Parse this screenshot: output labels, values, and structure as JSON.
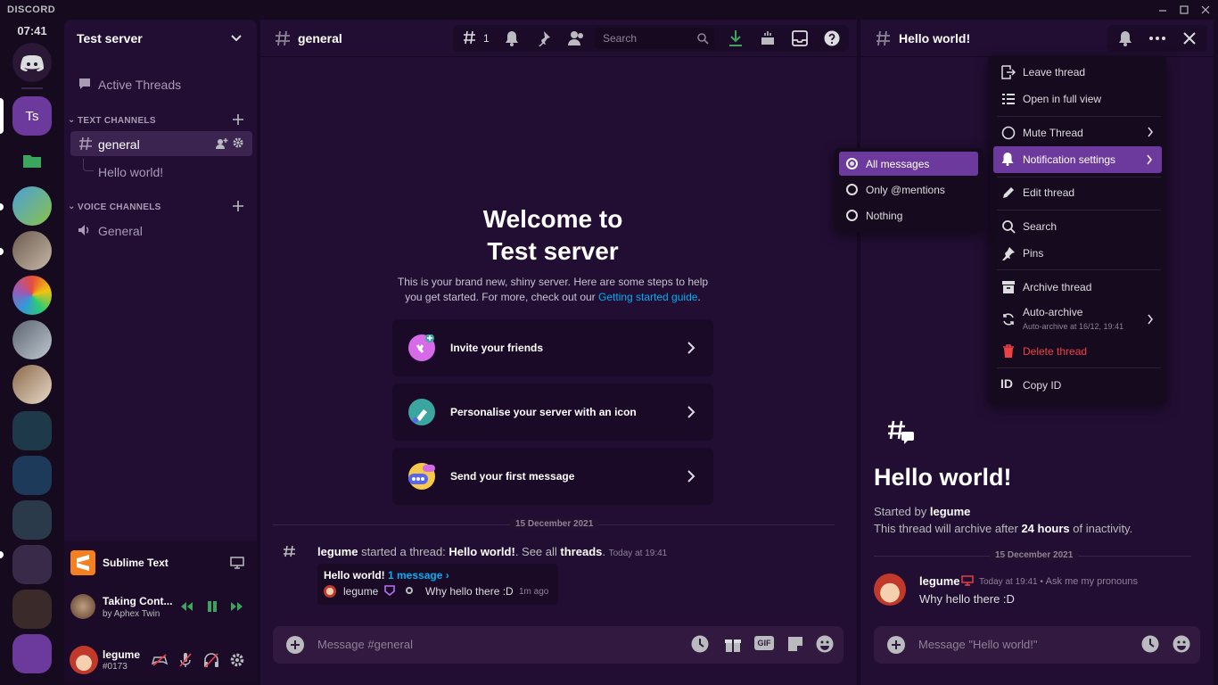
{
  "app": {
    "brand": "DISCORD",
    "time": "07:41"
  },
  "server": {
    "name": "Test server",
    "active_threads": "Active Threads",
    "text_category": "TEXT CHANNELS",
    "voice_category": "VOICE CHANNELS",
    "channels": {
      "general": "general",
      "thread": "Hello world!",
      "voice": "General"
    },
    "guild_initials": "Ts"
  },
  "activity": {
    "app_name": "Sublime Text",
    "song_title": "Taking Cont...",
    "song_artist": "by Aphex Twin"
  },
  "user": {
    "name": "legume",
    "tag": "#0173"
  },
  "main": {
    "channel": "general",
    "thread_count": "1",
    "search_placeholder": "Search",
    "welcome_line1": "Welcome to",
    "welcome_line2": "Test server",
    "welcome_sub": "This is your brand new, shiny server. Here are some steps to help you get started. For more, check out our",
    "guide_link": "Getting started guide",
    "guide_suffix": ".",
    "cards": [
      "Invite your friends",
      "Personalise your server with an icon",
      "Send your first message"
    ],
    "divider_date": "15 December 2021",
    "system_msg": {
      "user": "legume",
      "text1": " started a thread: ",
      "thread": "Hello world!",
      "text2": ". See all ",
      "threads": "threads",
      "text3": ".",
      "time": "Today at 19:41",
      "preview_title": "Hello world!",
      "preview_count": "1 message ›",
      "preview_user": "legume",
      "preview_text": "Why hello there :D",
      "preview_time": "1m ago"
    },
    "composer_placeholder": "Message #general"
  },
  "thread": {
    "title": "Hello world!",
    "big_title": "Hello world!",
    "started_by": "Started by ",
    "starter": "legume",
    "archive_pre": "This thread will archive after ",
    "archive_hours": "24 hours",
    "archive_post": " of inactivity.",
    "divider_date": "15 December 2021",
    "message": {
      "user": "legume",
      "time": "Today at 19:41",
      "sep": " • ",
      "pronouns": "Ask me my pronouns",
      "text": "Why hello there :D"
    },
    "composer_placeholder": "Message \"Hello world!\""
  },
  "menu": {
    "leave": "Leave thread",
    "open_full": "Open in full view",
    "mute": "Mute Thread",
    "notif": "Notification settings",
    "edit": "Edit thread",
    "search": "Search",
    "pins": "Pins",
    "archive": "Archive thread",
    "auto_archive": "Auto-archive",
    "auto_archive_sub": "Auto-archive at 16/12, 19:41",
    "delete": "Delete thread",
    "copy_id": "Copy ID"
  },
  "notif_submenu": [
    "All messages",
    "Only @mentions",
    "Nothing"
  ],
  "colors": {
    "accent": "#6c3a9c",
    "danger": "#ed4245",
    "link": "#00aff4",
    "green": "#3ba55d"
  }
}
